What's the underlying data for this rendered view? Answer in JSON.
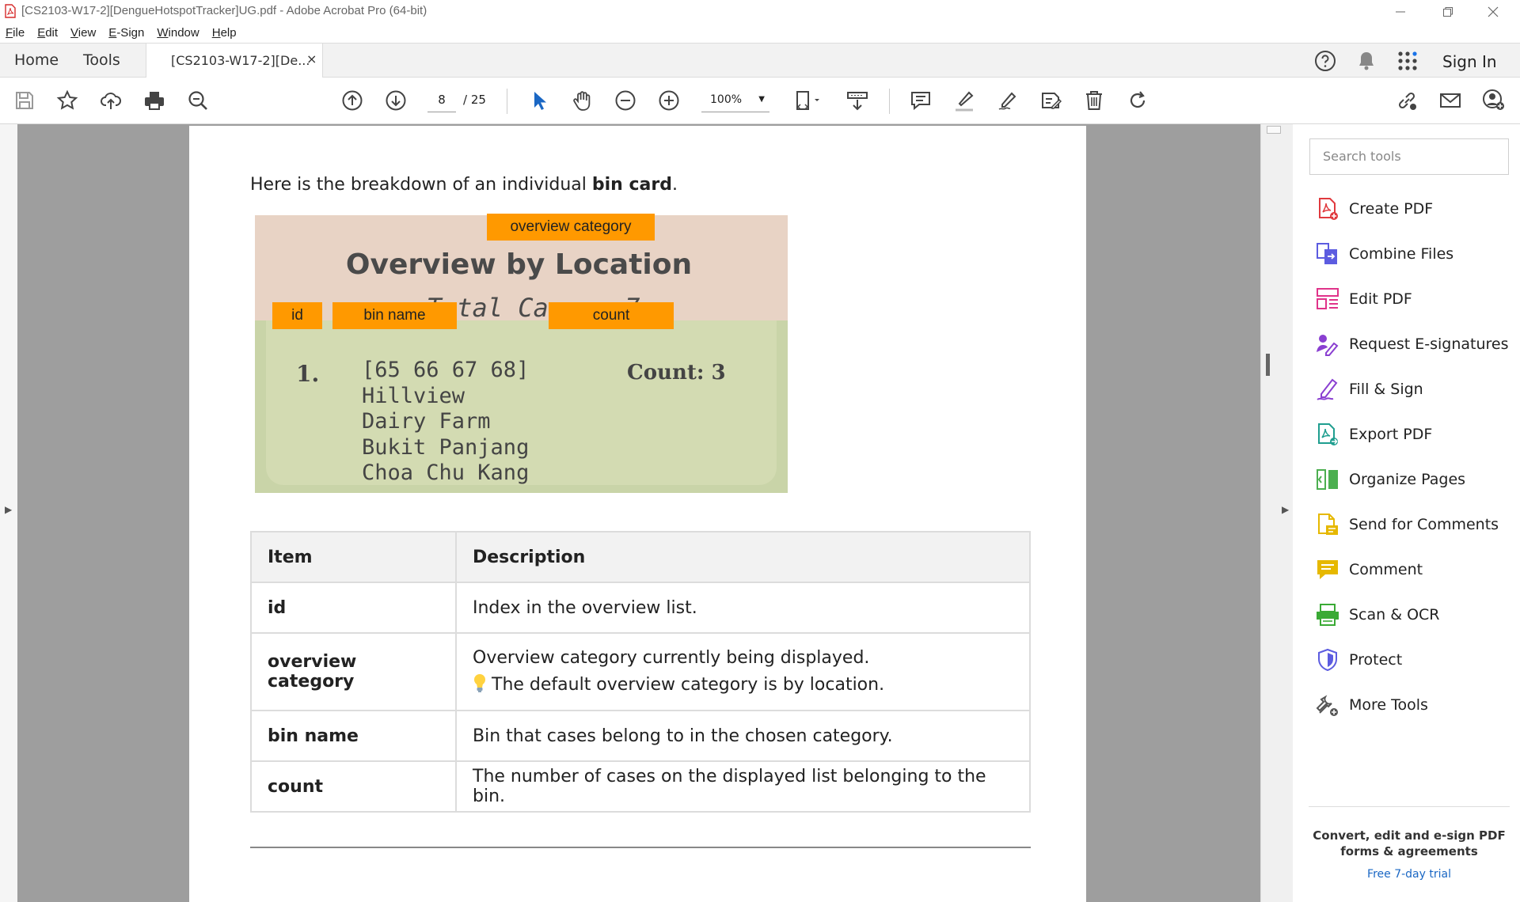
{
  "window": {
    "title": "[CS2103-W17-2][DengueHotspotTracker]UG.pdf - Adobe Acrobat Pro (64-bit)"
  },
  "menu": [
    "File",
    "Edit",
    "View",
    "E-Sign",
    "Window",
    "Help"
  ],
  "tabs": {
    "home": "Home",
    "tools": "Tools",
    "document": "[CS2103-W17-2][De...",
    "close": "×",
    "sign_in": "Sign In"
  },
  "toolbar": {
    "page_current": "8",
    "page_total": "/ 25",
    "zoom": "100%"
  },
  "document": {
    "intro_pre": "Here is the breakdown of an individual ",
    "intro_bold": "bin card",
    "intro_post": ".",
    "bin_card": {
      "title": "Overview by Location",
      "total": "Total Cases: 7",
      "index": "1.",
      "bin_lines": [
        "[65 66 67 68]",
        "Hillview",
        "Dairy Farm",
        "Bukit Panjang",
        "Choa Chu Kang"
      ],
      "count": "Count: 3",
      "tags": {
        "overview_category": "overview category",
        "id": "id",
        "bin_name": "bin name",
        "count": "count"
      }
    },
    "table": {
      "headers": [
        "Item",
        "Description"
      ],
      "rows": [
        {
          "item": "id",
          "desc": "Index in the overview list.",
          "note": ""
        },
        {
          "item": "overview category",
          "desc": "Overview category currently being displayed.",
          "note": "The default overview category is by location."
        },
        {
          "item": "bin name",
          "desc": "Bin that cases belong to in the chosen category.",
          "note": ""
        },
        {
          "item": "count",
          "desc": "The number of cases on the displayed list belonging to the bin.",
          "note": ""
        }
      ]
    }
  },
  "tools_pane": {
    "search_placeholder": "Search tools",
    "items": [
      {
        "label": "Create PDF",
        "icon": "create-pdf-icon",
        "color": "#e03a3e"
      },
      {
        "label": "Combine Files",
        "icon": "combine-files-icon",
        "color": "#5c5ce0"
      },
      {
        "label": "Edit PDF",
        "icon": "edit-pdf-icon",
        "color": "#e0338a"
      },
      {
        "label": "Request E-signatures",
        "icon": "request-esign-icon",
        "color": "#8a3fd1"
      },
      {
        "label": "Fill & Sign",
        "icon": "fill-sign-icon",
        "color": "#8a3fd1"
      },
      {
        "label": "Export PDF",
        "icon": "export-pdf-icon",
        "color": "#1f9e8f"
      },
      {
        "label": "Organize Pages",
        "icon": "organize-pages-icon",
        "color": "#4caf50"
      },
      {
        "label": "Send for Comments",
        "icon": "send-comments-icon",
        "color": "#e6b800"
      },
      {
        "label": "Comment",
        "icon": "comment-icon",
        "color": "#e6b800"
      },
      {
        "label": "Scan & OCR",
        "icon": "scan-ocr-icon",
        "color": "#3aaa35"
      },
      {
        "label": "Protect",
        "icon": "protect-icon",
        "color": "#5c5ce0"
      },
      {
        "label": "More Tools",
        "icon": "more-tools-icon",
        "color": "#555555"
      }
    ],
    "promo": "Convert, edit and e-sign PDF forms & agreements",
    "trial": "Free 7-day trial"
  },
  "colors": {
    "tag_orange": "#ff9900",
    "card_header": "#e8d3c5",
    "card_body": "#c9d4a8",
    "link_blue": "#1a67c4"
  }
}
